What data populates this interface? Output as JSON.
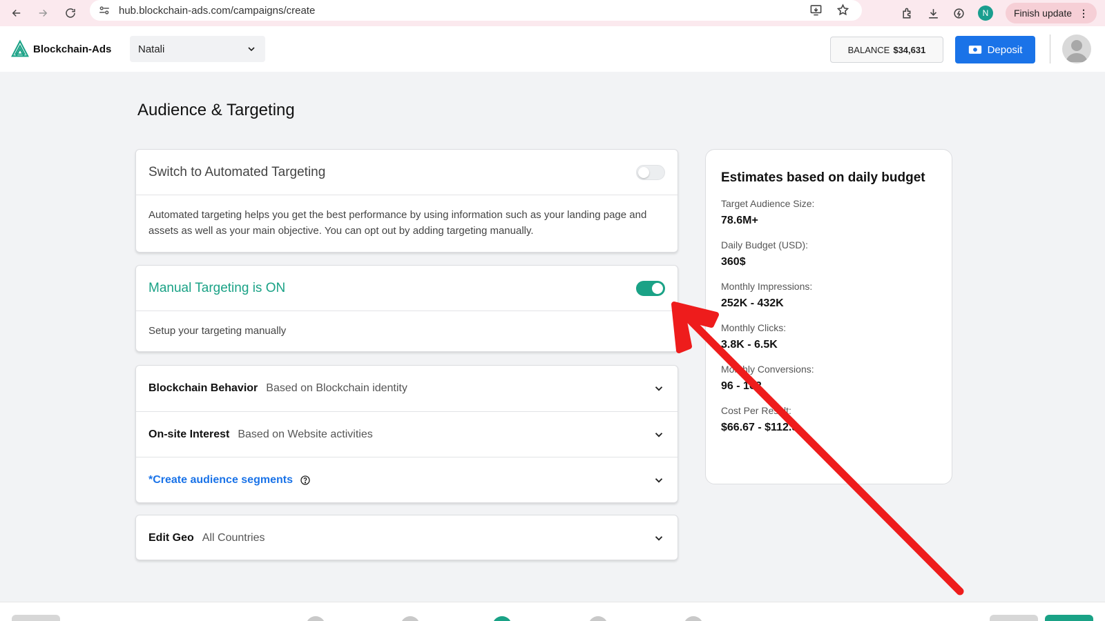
{
  "browser": {
    "url": "hub.blockchain-ads.com/campaigns/create",
    "profile_initial": "N",
    "finish_update_label": "Finish update"
  },
  "header": {
    "logo_text": "Blockchain-Ads",
    "account_selected": "Natali",
    "balance_label": "BALANCE",
    "balance_value": "$34,631",
    "deposit_label": "Deposit"
  },
  "page": {
    "title": "Audience & Targeting"
  },
  "automated": {
    "title": "Switch to Automated Targeting",
    "enabled": false,
    "description": "Automated targeting helps you get the best performance by using information such as your landing page and assets as well as your main objective. You can opt out by adding targeting manually."
  },
  "manual": {
    "title": "Manual Targeting is ON",
    "enabled": true,
    "description": "Setup your targeting manually"
  },
  "targeting_sections": [
    {
      "title": "Blockchain Behavior",
      "subtitle": "Based on Blockchain identity"
    },
    {
      "title": "On-site Interest",
      "subtitle": "Based on Website activities"
    },
    {
      "title": "*Create audience segments",
      "subtitle": ""
    }
  ],
  "geo": {
    "title": "Edit Geo",
    "subtitle": "All Countries"
  },
  "estimates": {
    "title": "Estimates based on daily budget",
    "items": [
      {
        "label": "Target Audience Size:",
        "value": "78.6M+"
      },
      {
        "label": "Daily Budget (USD):",
        "value": "360$"
      },
      {
        "label": "Monthly Impressions:",
        "value": "252K - 432K"
      },
      {
        "label": "Monthly Clicks:",
        "value": "3.8K - 6.5K"
      },
      {
        "label": "Monthly Conversions:",
        "value": "96 - 162"
      },
      {
        "label": "Cost Per Result:",
        "value": "$66.67 - $112.5"
      }
    ]
  },
  "colors": {
    "accent_green": "#1aa286",
    "primary_blue": "#1a73e8",
    "annotation_red": "#ee1c1c"
  }
}
